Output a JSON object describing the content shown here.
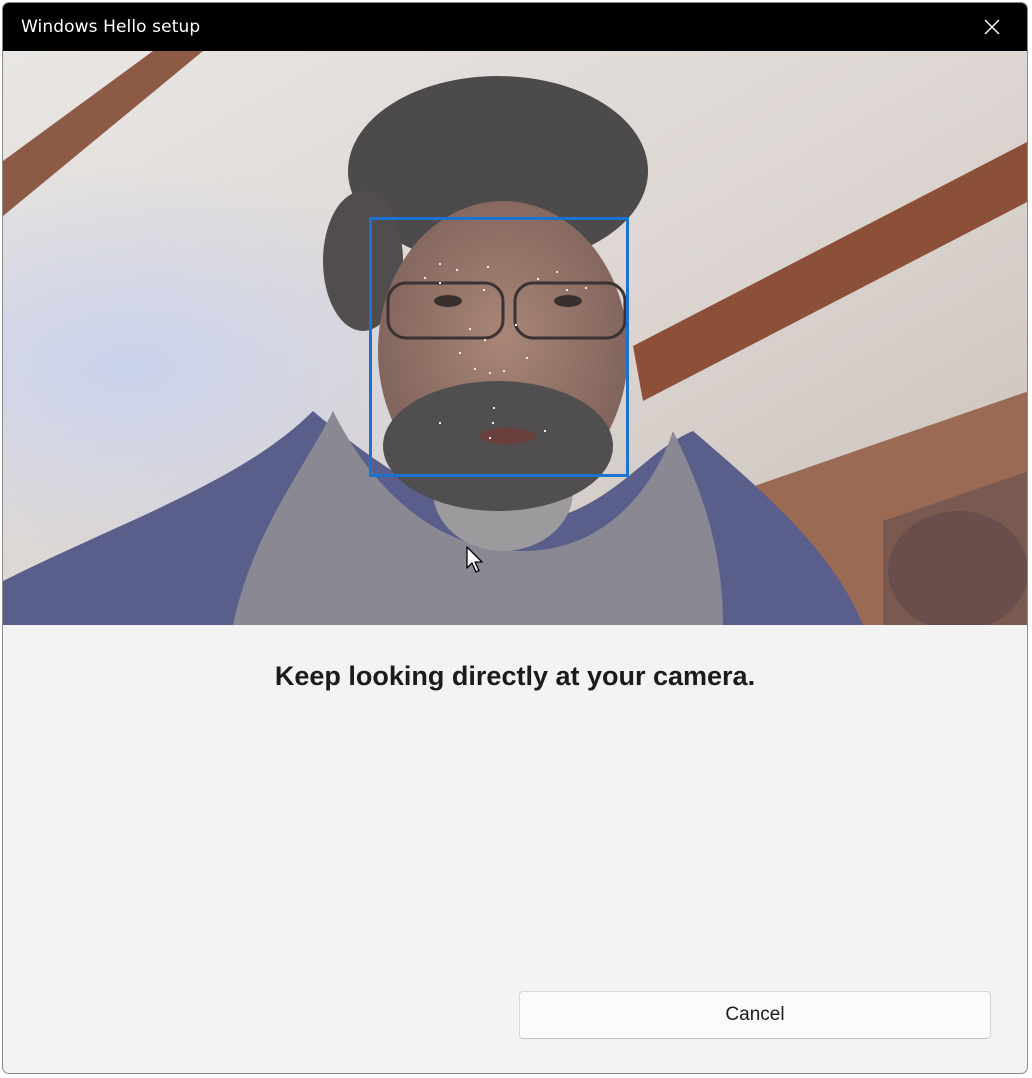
{
  "window": {
    "title": "Windows Hello setup"
  },
  "camera": {
    "description_icon": "camera-feed"
  },
  "message": "Keep looking directly at your camera.",
  "buttons": {
    "cancel_label": "Cancel"
  },
  "colors": {
    "titlebar": "#000000",
    "face_box": "#1a73d1",
    "background": "#f3f3f3"
  }
}
